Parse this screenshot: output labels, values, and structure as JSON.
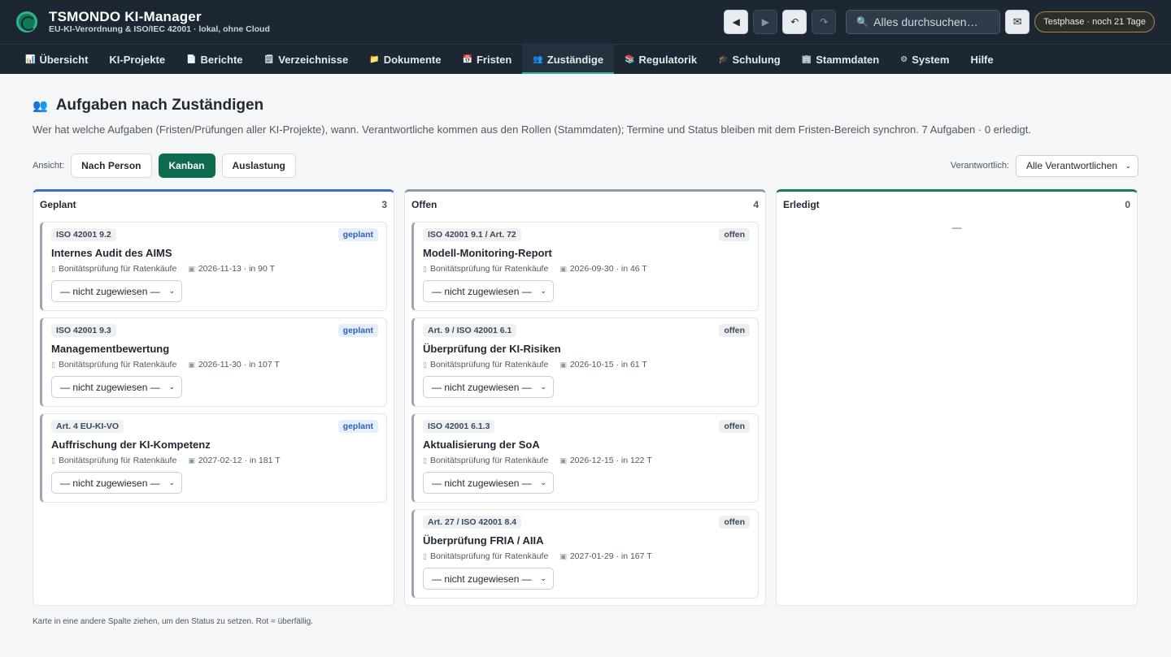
{
  "app": {
    "title": "TSMONDO KI-Manager",
    "subtitle": "EU-KI-Verordnung & ISO/IEC 42001 · lokal, ohne Cloud",
    "search_placeholder": "Alles durchsuchen…",
    "trial": "Testphase · noch 21 Tage",
    "icons": {
      "back": "triangle-left",
      "forward": "triangle-right",
      "undo": "undo-arrow",
      "redo": "redo-arrow",
      "search": "magnifier",
      "mail": "envelope"
    }
  },
  "nav": [
    {
      "icon": "📊",
      "label": "Übersicht"
    },
    {
      "icon": "",
      "label": "KI-Projekte"
    },
    {
      "icon": "📄",
      "label": "Berichte"
    },
    {
      "icon": "🗒",
      "label": "Verzeichnisse"
    },
    {
      "icon": "📁",
      "label": "Dokumente"
    },
    {
      "icon": "📅",
      "label": "Fristen"
    },
    {
      "icon": "👥",
      "label": "Zuständige",
      "active": true
    },
    {
      "icon": "📚",
      "label": "Regulatorik"
    },
    {
      "icon": "🎓",
      "label": "Schulung"
    },
    {
      "icon": "🏢",
      "label": "Stammdaten"
    },
    {
      "icon": "⚙",
      "label": "System"
    },
    {
      "icon": "",
      "label": "Hilfe"
    }
  ],
  "page": {
    "title": "Aufgaben nach Zuständigen",
    "description": "Wer hat welche Aufgaben (Fristen/Prüfungen aller KI-Projekte), wann. Verantwortliche kommen aus den Rollen (Stammdaten); Termine und Status bleiben mit dem Fristen-Bereich synchron. 7 Aufgaben · 0 erledigt.",
    "view_label": "Ansicht:",
    "views": [
      "Nach Person",
      "Kanban",
      "Auslastung"
    ],
    "active_view": "Kanban",
    "filter_label": "Verantwortlich:",
    "filter_value": "Alle Verantwortlichen",
    "footer": "Karte in eine andere Spalte ziehen, um den Status zu setzen. Rot = überfällig."
  },
  "columns": [
    {
      "name": "Geplant",
      "count": "3",
      "cards": [
        {
          "ref": "ISO 42001 9.2",
          "status": "geplant",
          "title": "Internes Audit des AIMS",
          "project": "Bonitätsprüfung für Ratenkäufe",
          "date": "2026-11-13 · in 90 T",
          "assignee": "— nicht zugewiesen —"
        },
        {
          "ref": "ISO 42001 9.3",
          "status": "geplant",
          "title": "Managementbewertung",
          "project": "Bonitätsprüfung für Ratenkäufe",
          "date": "2026-11-30 · in 107 T",
          "assignee": "— nicht zugewiesen —"
        },
        {
          "ref": "Art. 4 EU-KI-VO",
          "status": "geplant",
          "title": "Auffrischung der KI-Kompetenz",
          "project": "Bonitätsprüfung für Ratenkäufe",
          "date": "2027-02-12 · in 181 T",
          "assignee": "— nicht zugewiesen —"
        }
      ]
    },
    {
      "name": "Offen",
      "count": "4",
      "cards": [
        {
          "ref": "ISO 42001 9.1 / Art. 72",
          "status": "offen",
          "title": "Modell-Monitoring-Report",
          "project": "Bonitätsprüfung für Ratenkäufe",
          "date": "2026-09-30 · in 46 T",
          "assignee": "— nicht zugewiesen —"
        },
        {
          "ref": "Art. 9 / ISO 42001 6.1",
          "status": "offen",
          "title": "Überprüfung der KI-Risiken",
          "project": "Bonitätsprüfung für Ratenkäufe",
          "date": "2026-10-15 · in 61 T",
          "assignee": "— nicht zugewiesen —"
        },
        {
          "ref": "ISO 42001 6.1.3",
          "status": "offen",
          "title": "Aktualisierung der SoA",
          "project": "Bonitätsprüfung für Ratenkäufe",
          "date": "2026-12-15 · in 122 T",
          "assignee": "— nicht zugewiesen —"
        },
        {
          "ref": "Art. 27 / ISO 42001 8.4",
          "status": "offen",
          "title": "Überprüfung FRIA / AIIA",
          "project": "Bonitätsprüfung für Ratenkäufe",
          "date": "2027-01-29 · in 167 T",
          "assignee": "— nicht zugewiesen —"
        }
      ]
    },
    {
      "name": "Erledigt",
      "count": "0",
      "empty": "—",
      "cards": []
    }
  ]
}
